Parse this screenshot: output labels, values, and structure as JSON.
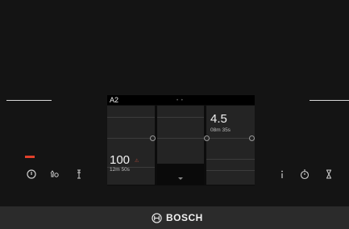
{
  "display": {
    "header_label": "A2",
    "header_dots": "• •",
    "left_zone": {
      "level": "100",
      "time": "12m 50s"
    },
    "right_zone": {
      "level": "4.5",
      "time": "08m 35s"
    }
  },
  "controls": {
    "left": [
      "power-icon",
      "childlock-icon",
      "timer-key-icon"
    ],
    "right": [
      "info-icon",
      "clock-timer-icon",
      "hourglass-icon"
    ]
  },
  "status": {
    "active_indicator_color": "#e2402b"
  },
  "brand": {
    "name": "BOSCH"
  }
}
